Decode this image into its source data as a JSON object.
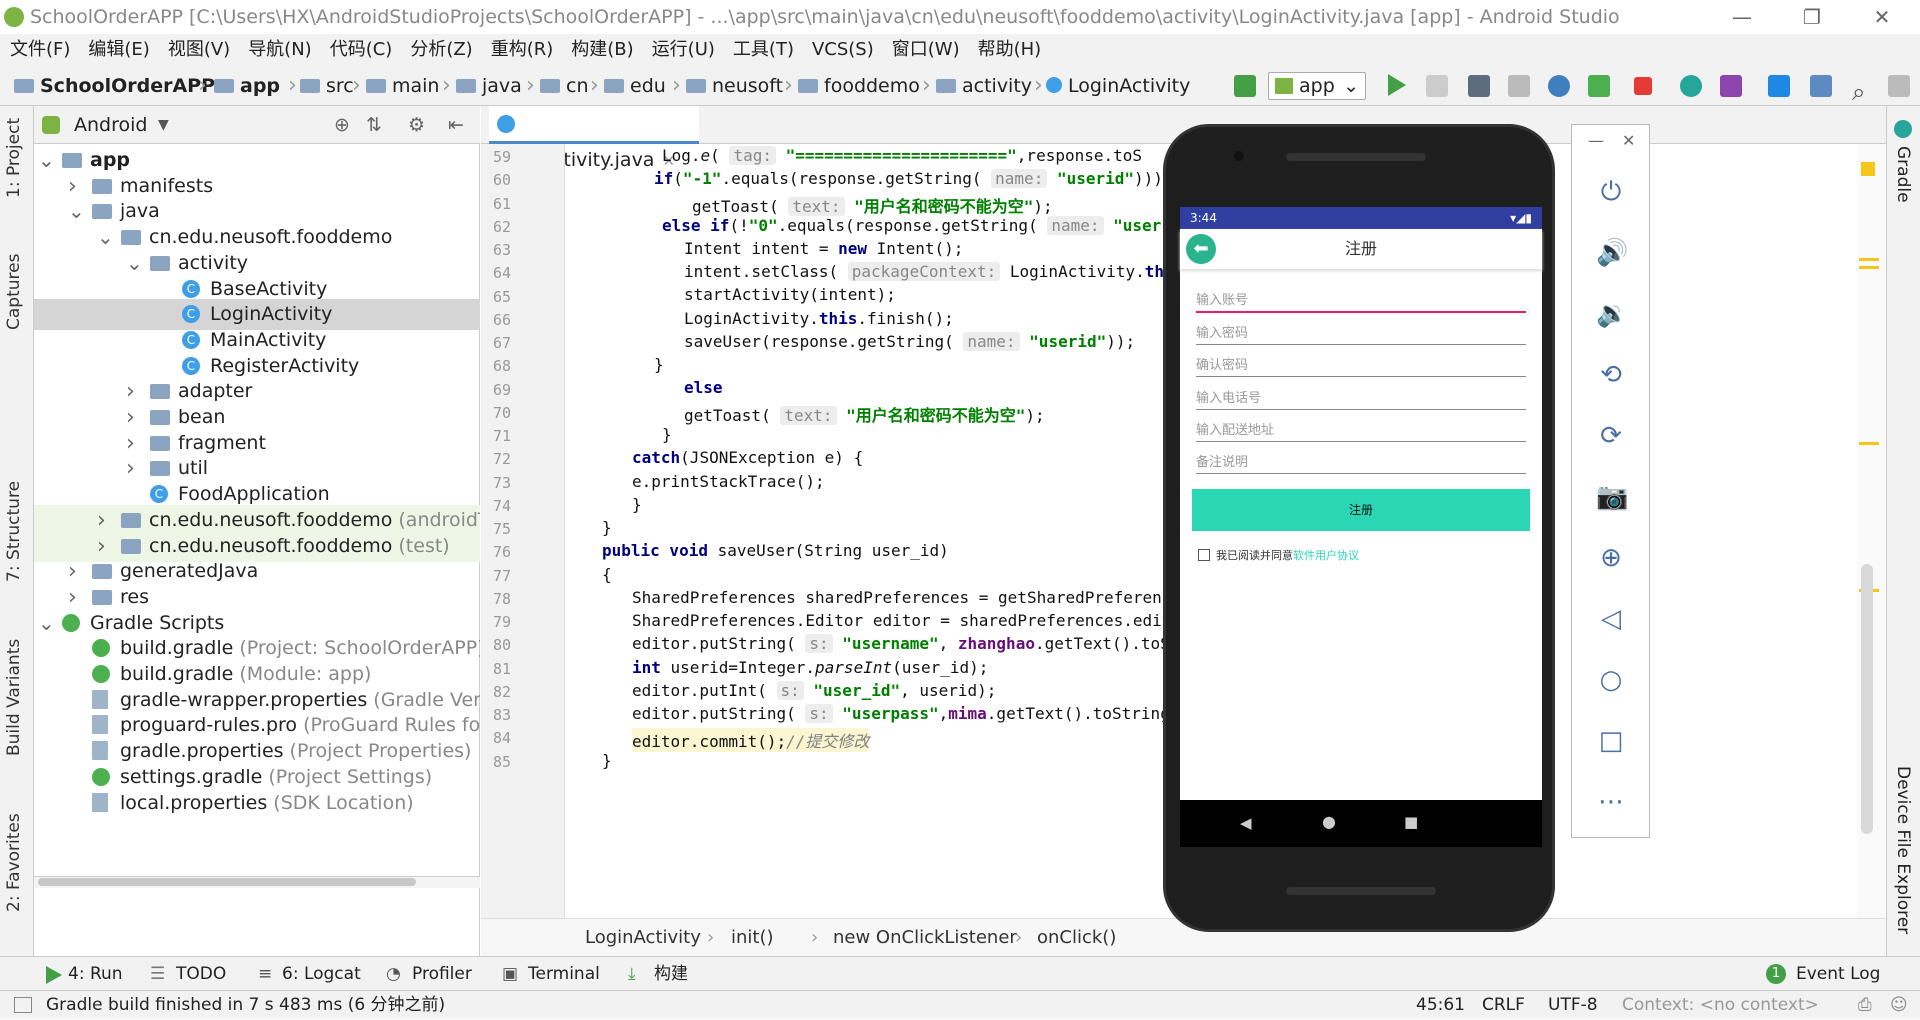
{
  "window": {
    "title": "SchoolOrderAPP [C:\\Users\\HX\\AndroidStudioProjects\\SchoolOrderAPP] - ...\\app\\src\\main\\java\\cn\\edu\\neusoft\\fooddemo\\activity\\LoginActivity.java [app] - Android Studio"
  },
  "menu": [
    "文件(F)",
    "编辑(E)",
    "视图(V)",
    "导航(N)",
    "代码(C)",
    "分析(Z)",
    "重构(R)",
    "构建(B)",
    "运行(U)",
    "工具(T)",
    "VCS(S)",
    "窗口(W)",
    "帮助(H)"
  ],
  "breadcrumb": [
    "SchoolOrderAPP",
    "app",
    "src",
    "main",
    "java",
    "cn",
    "edu",
    "neusoft",
    "fooddemo",
    "activity",
    "LoginActivity"
  ],
  "run_config": "app",
  "left_tabs": [
    "1: Project",
    "Captures",
    "7: Structure",
    "Build Variants",
    "2: Favorites"
  ],
  "right_tabs": [
    "Gradle",
    "Device File Explorer"
  ],
  "project": {
    "view": "Android",
    "tree": [
      {
        "label": "app",
        "bold": true
      },
      {
        "label": "manifests"
      },
      {
        "label": "java"
      },
      {
        "label": "cn.edu.neusoft.fooddemo"
      },
      {
        "label": "activity"
      },
      {
        "label": "BaseActivity"
      },
      {
        "label": "LoginActivity"
      },
      {
        "label": "MainActivity"
      },
      {
        "label": "RegisterActivity"
      },
      {
        "label": "adapter"
      },
      {
        "label": "bean"
      },
      {
        "label": "fragment"
      },
      {
        "label": "util"
      },
      {
        "label": "FoodApplication"
      },
      {
        "label": "cn.edu.neusoft.fooddemo",
        "suffix": "(androidTest)"
      },
      {
        "label": "cn.edu.neusoft.fooddemo",
        "suffix": "(test)"
      },
      {
        "label": "generatedJava"
      },
      {
        "label": "res"
      },
      {
        "label": "Gradle Scripts"
      },
      {
        "label": "build.gradle",
        "suffix": "(Project: SchoolOrderAPP)"
      },
      {
        "label": "build.gradle",
        "suffix": "(Module: app)"
      },
      {
        "label": "gradle-wrapper.properties",
        "suffix": "(Gradle Version)"
      },
      {
        "label": "proguard-rules.pro",
        "suffix": "(ProGuard Rules for app)"
      },
      {
        "label": "gradle.properties",
        "suffix": "(Project Properties)"
      },
      {
        "label": "settings.gradle",
        "suffix": "(Project Settings)"
      },
      {
        "label": "local.properties",
        "suffix": "(SDK Location)"
      }
    ]
  },
  "editor": {
    "tab": "LoginActivity.java",
    "line_numbers": [
      "59",
      "60",
      "61",
      "62",
      "63",
      "64",
      "65",
      "66",
      "67",
      "68",
      "69",
      "70",
      "71",
      "72",
      "73",
      "74",
      "75",
      "76",
      "77",
      "78",
      "79",
      "80",
      "81",
      "82",
      "83",
      "84",
      "85"
    ]
  },
  "code_crumbs": [
    "LoginActivity",
    "init()",
    "new OnClickListener",
    "onClick()"
  ],
  "bottom_tabs": [
    "4: Run",
    "TODO",
    "6: Logcat",
    "Profiler",
    "Terminal",
    "构建"
  ],
  "event_log": "Event Log",
  "event_count": "1",
  "status": {
    "message": "Gradle build finished in 7 s 483 ms (6 分钟之前)",
    "position": "45:61",
    "line_sep": "CRLF",
    "encoding": "UTF-8",
    "context": "Context: <no context>"
  },
  "phone": {
    "time": "3:44",
    "title": "注册",
    "fields": [
      "输入账号",
      "输入密码",
      "确认密码",
      "输入电话号",
      "输入配送地址",
      "备注说明"
    ],
    "button": "注册",
    "agree_text": "我已阅读并同意",
    "agree_link": "软件用户协议",
    "accent": "#2ad6b4",
    "statusbar_color": "#303f9f"
  }
}
